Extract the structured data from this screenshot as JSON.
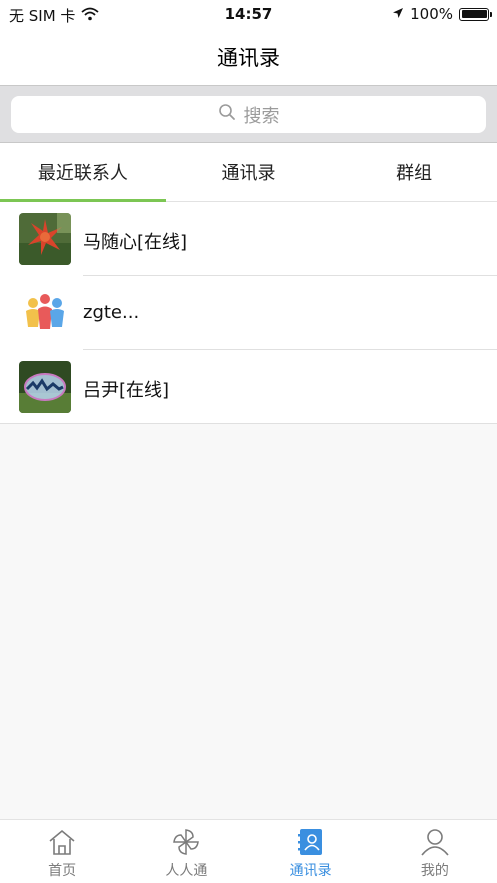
{
  "status_bar": {
    "carrier": "无 SIM 卡",
    "time": "14:57",
    "battery": "100%",
    "battery_level": 1.0
  },
  "nav": {
    "title": "通讯录"
  },
  "search": {
    "placeholder": "搜索"
  },
  "tabs": [
    {
      "label": "最近联系人",
      "active": true
    },
    {
      "label": "通讯录",
      "active": false
    },
    {
      "label": "群组",
      "active": false
    }
  ],
  "contacts": [
    {
      "name": "马随心[在线]",
      "avatar": "red-flower-photo"
    },
    {
      "name": "zgte...",
      "avatar": "colorful-people-group-logo"
    },
    {
      "name": "吕尹[在线]",
      "avatar": "bubble-on-leaf-photo"
    }
  ],
  "tab_bar": [
    {
      "label": "首页",
      "icon": "home-icon",
      "active": false
    },
    {
      "label": "人人通",
      "icon": "pinwheel-icon",
      "active": false
    },
    {
      "label": "通讯录",
      "icon": "contacts-book-icon",
      "active": true
    },
    {
      "label": "我的",
      "icon": "person-icon",
      "active": false
    }
  ],
  "colors": {
    "accent_green": "#7cc653",
    "active_blue": "#3a8fe0"
  }
}
